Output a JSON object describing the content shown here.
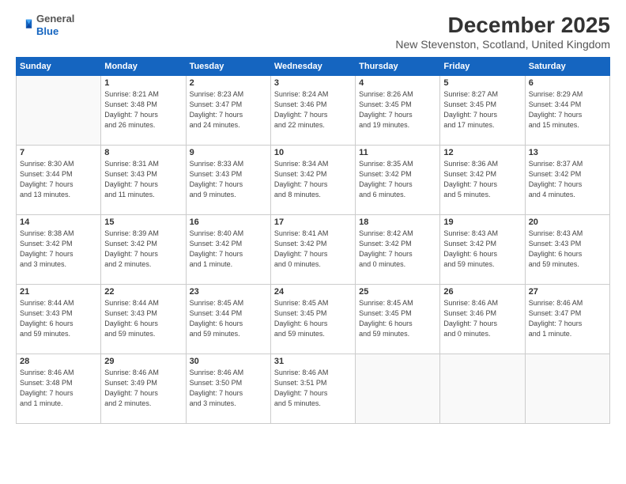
{
  "logo": {
    "general": "General",
    "blue": "Blue"
  },
  "header": {
    "month": "December 2025",
    "location": "New Stevenston, Scotland, United Kingdom"
  },
  "weekdays": [
    "Sunday",
    "Monday",
    "Tuesday",
    "Wednesday",
    "Thursday",
    "Friday",
    "Saturday"
  ],
  "weeks": [
    [
      {
        "day": "",
        "detail": ""
      },
      {
        "day": "1",
        "detail": "Sunrise: 8:21 AM\nSunset: 3:48 PM\nDaylight: 7 hours\nand 26 minutes."
      },
      {
        "day": "2",
        "detail": "Sunrise: 8:23 AM\nSunset: 3:47 PM\nDaylight: 7 hours\nand 24 minutes."
      },
      {
        "day": "3",
        "detail": "Sunrise: 8:24 AM\nSunset: 3:46 PM\nDaylight: 7 hours\nand 22 minutes."
      },
      {
        "day": "4",
        "detail": "Sunrise: 8:26 AM\nSunset: 3:45 PM\nDaylight: 7 hours\nand 19 minutes."
      },
      {
        "day": "5",
        "detail": "Sunrise: 8:27 AM\nSunset: 3:45 PM\nDaylight: 7 hours\nand 17 minutes."
      },
      {
        "day": "6",
        "detail": "Sunrise: 8:29 AM\nSunset: 3:44 PM\nDaylight: 7 hours\nand 15 minutes."
      }
    ],
    [
      {
        "day": "7",
        "detail": "Sunrise: 8:30 AM\nSunset: 3:44 PM\nDaylight: 7 hours\nand 13 minutes."
      },
      {
        "day": "8",
        "detail": "Sunrise: 8:31 AM\nSunset: 3:43 PM\nDaylight: 7 hours\nand 11 minutes."
      },
      {
        "day": "9",
        "detail": "Sunrise: 8:33 AM\nSunset: 3:43 PM\nDaylight: 7 hours\nand 9 minutes."
      },
      {
        "day": "10",
        "detail": "Sunrise: 8:34 AM\nSunset: 3:42 PM\nDaylight: 7 hours\nand 8 minutes."
      },
      {
        "day": "11",
        "detail": "Sunrise: 8:35 AM\nSunset: 3:42 PM\nDaylight: 7 hours\nand 6 minutes."
      },
      {
        "day": "12",
        "detail": "Sunrise: 8:36 AM\nSunset: 3:42 PM\nDaylight: 7 hours\nand 5 minutes."
      },
      {
        "day": "13",
        "detail": "Sunrise: 8:37 AM\nSunset: 3:42 PM\nDaylight: 7 hours\nand 4 minutes."
      }
    ],
    [
      {
        "day": "14",
        "detail": "Sunrise: 8:38 AM\nSunset: 3:42 PM\nDaylight: 7 hours\nand 3 minutes."
      },
      {
        "day": "15",
        "detail": "Sunrise: 8:39 AM\nSunset: 3:42 PM\nDaylight: 7 hours\nand 2 minutes."
      },
      {
        "day": "16",
        "detail": "Sunrise: 8:40 AM\nSunset: 3:42 PM\nDaylight: 7 hours\nand 1 minute."
      },
      {
        "day": "17",
        "detail": "Sunrise: 8:41 AM\nSunset: 3:42 PM\nDaylight: 7 hours\nand 0 minutes."
      },
      {
        "day": "18",
        "detail": "Sunrise: 8:42 AM\nSunset: 3:42 PM\nDaylight: 7 hours\nand 0 minutes."
      },
      {
        "day": "19",
        "detail": "Sunrise: 8:43 AM\nSunset: 3:42 PM\nDaylight: 6 hours\nand 59 minutes."
      },
      {
        "day": "20",
        "detail": "Sunrise: 8:43 AM\nSunset: 3:43 PM\nDaylight: 6 hours\nand 59 minutes."
      }
    ],
    [
      {
        "day": "21",
        "detail": "Sunrise: 8:44 AM\nSunset: 3:43 PM\nDaylight: 6 hours\nand 59 minutes."
      },
      {
        "day": "22",
        "detail": "Sunrise: 8:44 AM\nSunset: 3:43 PM\nDaylight: 6 hours\nand 59 minutes."
      },
      {
        "day": "23",
        "detail": "Sunrise: 8:45 AM\nSunset: 3:44 PM\nDaylight: 6 hours\nand 59 minutes."
      },
      {
        "day": "24",
        "detail": "Sunrise: 8:45 AM\nSunset: 3:45 PM\nDaylight: 6 hours\nand 59 minutes."
      },
      {
        "day": "25",
        "detail": "Sunrise: 8:45 AM\nSunset: 3:45 PM\nDaylight: 6 hours\nand 59 minutes."
      },
      {
        "day": "26",
        "detail": "Sunrise: 8:46 AM\nSunset: 3:46 PM\nDaylight: 7 hours\nand 0 minutes."
      },
      {
        "day": "27",
        "detail": "Sunrise: 8:46 AM\nSunset: 3:47 PM\nDaylight: 7 hours\nand 1 minute."
      }
    ],
    [
      {
        "day": "28",
        "detail": "Sunrise: 8:46 AM\nSunset: 3:48 PM\nDaylight: 7 hours\nand 1 minute."
      },
      {
        "day": "29",
        "detail": "Sunrise: 8:46 AM\nSunset: 3:49 PM\nDaylight: 7 hours\nand 2 minutes."
      },
      {
        "day": "30",
        "detail": "Sunrise: 8:46 AM\nSunset: 3:50 PM\nDaylight: 7 hours\nand 3 minutes."
      },
      {
        "day": "31",
        "detail": "Sunrise: 8:46 AM\nSunset: 3:51 PM\nDaylight: 7 hours\nand 5 minutes."
      },
      {
        "day": "",
        "detail": ""
      },
      {
        "day": "",
        "detail": ""
      },
      {
        "day": "",
        "detail": ""
      }
    ]
  ]
}
